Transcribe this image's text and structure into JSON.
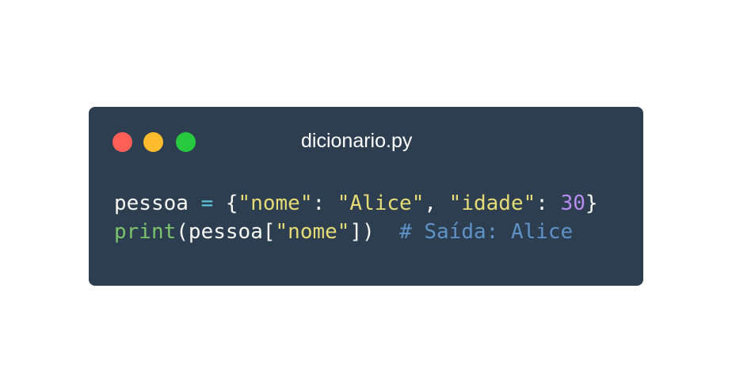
{
  "window": {
    "title": "dicionario.py",
    "background": "#2c3e50",
    "controls": [
      {
        "name": "close",
        "color": "#ff5f56"
      },
      {
        "name": "minimize",
        "color": "#ffbd2e"
      },
      {
        "name": "maximize",
        "color": "#27c93f"
      }
    ]
  },
  "code": {
    "lines": [
      [
        {
          "text": "pessoa ",
          "color": "#f8f8f2"
        },
        {
          "text": "=",
          "color": "#5fc9e3"
        },
        {
          "text": " {",
          "color": "#f8f8f2"
        },
        {
          "text": "\"nome\"",
          "color": "#e6db74"
        },
        {
          "text": ": ",
          "color": "#f8f8f2"
        },
        {
          "text": "\"Alice\"",
          "color": "#e6db74"
        },
        {
          "text": ", ",
          "color": "#f8f8f2"
        },
        {
          "text": "\"idade\"",
          "color": "#e6db74"
        },
        {
          "text": ": ",
          "color": "#f8f8f2"
        },
        {
          "text": "30",
          "color": "#b98cf0"
        },
        {
          "text": "}",
          "color": "#f8f8f2"
        }
      ],
      [
        {
          "text": "print",
          "color": "#7cc36e"
        },
        {
          "text": "(pessoa[",
          "color": "#f8f8f2"
        },
        {
          "text": "\"nome\"",
          "color": "#e6db74"
        },
        {
          "text": "])  ",
          "color": "#f8f8f2"
        },
        {
          "text": "# Saída: Alice",
          "color": "#5f93c8"
        }
      ]
    ]
  }
}
